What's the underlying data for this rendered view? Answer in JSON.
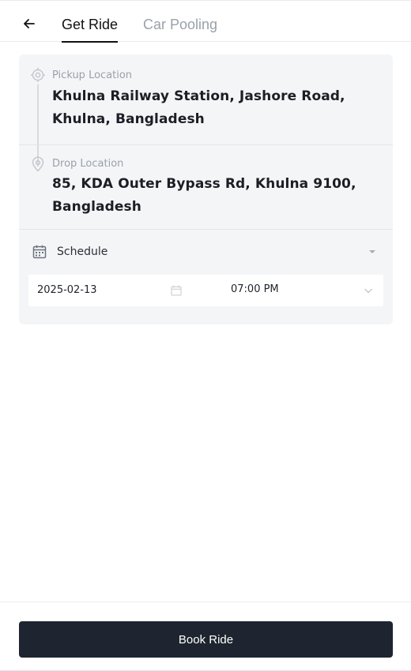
{
  "header": {
    "back_icon": "arrow-left-icon",
    "tabs": [
      {
        "label": "Get Ride",
        "active": true
      },
      {
        "label": "Car Pooling",
        "active": false
      }
    ]
  },
  "route": {
    "pickup": {
      "icon": "location-target-icon",
      "label": "Pickup Location",
      "value": "Khulna Railway Station, Jashore Road, Khulna, Bangladesh"
    },
    "drop": {
      "icon": "map-pin-icon",
      "label": "Drop Location",
      "value": "85, KDA Outer Bypass Rd, Khulna 9100, Bangladesh"
    }
  },
  "schedule": {
    "icon": "calendar-icon",
    "label": "Schedule",
    "date": "2025-02-13",
    "time": "07:00 PM"
  },
  "footer": {
    "book_label": "Book Ride"
  },
  "colors": {
    "button_bg": "#1e2530",
    "card_bg": "#f4f5f7",
    "muted_text": "#9aa1ab"
  }
}
